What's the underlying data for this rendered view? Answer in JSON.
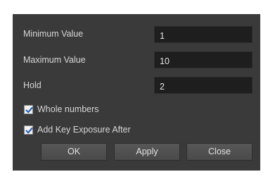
{
  "fields": [
    {
      "label": "Minimum Value",
      "value": "1"
    },
    {
      "label": "Maximum Value",
      "value": "10"
    },
    {
      "label": "Hold",
      "value": "2"
    }
  ],
  "options": [
    {
      "label": "Whole numbers",
      "checked": true
    },
    {
      "label": "Add Key Exposure After",
      "checked": true
    }
  ],
  "buttons": {
    "ok": "OK",
    "apply": "Apply",
    "close": "Close"
  },
  "colors": {
    "dialog_bg": "#3a3a3a",
    "input_bg": "#1e1e1e",
    "check_mark": "#2e63b3"
  }
}
